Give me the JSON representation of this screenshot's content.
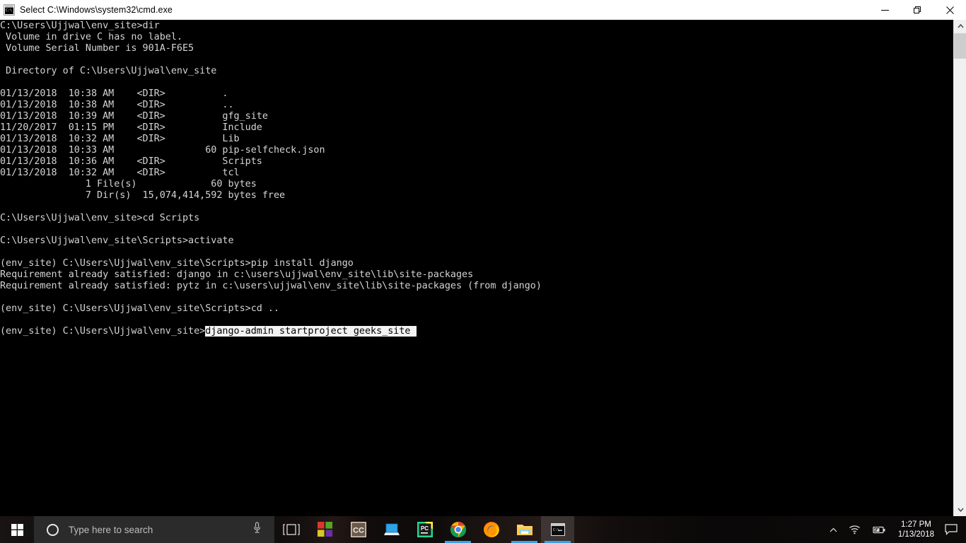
{
  "window": {
    "title": "Select C:\\Windows\\system32\\cmd.exe",
    "icon": "cmd-console-icon",
    "icon_glyph": "C:\\_",
    "controls": {
      "minimize_label": "Minimize",
      "restore_label": "Restore",
      "close_label": "Close"
    }
  },
  "console": {
    "background_color": "#000000",
    "foreground_color": "#d4d4d4",
    "selection_background": "#f2f2f2",
    "selection_foreground": "#000000",
    "lines": [
      {
        "text": "C:\\Users\\Ujjwal\\env_site>dir"
      },
      {
        "text": " Volume in drive C has no label."
      },
      {
        "text": " Volume Serial Number is 901A-F6E5"
      },
      {
        "text": ""
      },
      {
        "text": " Directory of C:\\Users\\Ujjwal\\env_site"
      },
      {
        "text": ""
      },
      {
        "text": "01/13/2018  10:38 AM    <DIR>          ."
      },
      {
        "text": "01/13/2018  10:38 AM    <DIR>          .."
      },
      {
        "text": "01/13/2018  10:39 AM    <DIR>          gfg_site"
      },
      {
        "text": "11/20/2017  01:15 PM    <DIR>          Include"
      },
      {
        "text": "01/13/2018  10:32 AM    <DIR>          Lib"
      },
      {
        "text": "01/13/2018  10:33 AM                60 pip-selfcheck.json"
      },
      {
        "text": "01/13/2018  10:36 AM    <DIR>          Scripts"
      },
      {
        "text": "01/13/2018  10:32 AM    <DIR>          tcl"
      },
      {
        "text": "               1 File(s)             60 bytes"
      },
      {
        "text": "               7 Dir(s)  15,074,414,592 bytes free"
      },
      {
        "text": ""
      },
      {
        "text": "C:\\Users\\Ujjwal\\env_site>cd Scripts"
      },
      {
        "text": ""
      },
      {
        "text": "C:\\Users\\Ujjwal\\env_site\\Scripts>activate"
      },
      {
        "text": ""
      },
      {
        "text": "(env_site) C:\\Users\\Ujjwal\\env_site\\Scripts>pip install django"
      },
      {
        "text": "Requirement already satisfied: django in c:\\users\\ujjwal\\env_site\\lib\\site-packages"
      },
      {
        "text": "Requirement already satisfied: pytz in c:\\users\\ujjwal\\env_site\\lib\\site-packages (from django)"
      },
      {
        "text": ""
      },
      {
        "text": "(env_site) C:\\Users\\Ujjwal\\env_site\\Scripts>cd .."
      },
      {
        "text": ""
      },
      {
        "prompt": "(env_site) C:\\Users\\Ujjwal\\env_site>",
        "selected": "django-admin startproject geeks_site "
      }
    ]
  },
  "scrollbar": {
    "up_arrow": "chevron-up-icon",
    "down_arrow": "chevron-down-icon",
    "thumb_color": "#cdcdcd",
    "track_color": "#f0f0f0"
  },
  "taskbar": {
    "start_button": "windows-start-icon",
    "search": {
      "placeholder": "Type here to search",
      "cortana_icon": "cortana-circle-icon",
      "mic_icon": "microphone-icon"
    },
    "task_view_icon": "task-view-icon",
    "apps": [
      {
        "name": "microsoft-store",
        "label": "Microsoft Store",
        "running": false,
        "active": false
      },
      {
        "name": "camtasia-cc",
        "label": "CC",
        "running": false,
        "active": false
      },
      {
        "name": "remote-desktop",
        "label": "Remote Desktop",
        "running": false,
        "active": false
      },
      {
        "name": "pycharm",
        "label": "PyCharm",
        "running": false,
        "active": false
      },
      {
        "name": "google-chrome",
        "label": "Google Chrome",
        "running": true,
        "active": false
      },
      {
        "name": "mozilla-firefox",
        "label": "Mozilla Firefox",
        "running": false,
        "active": false
      },
      {
        "name": "file-explorer",
        "label": "File Explorer",
        "running": true,
        "active": false
      },
      {
        "name": "command-prompt",
        "label": "Command Prompt",
        "running": true,
        "active": true
      }
    ],
    "tray": {
      "show_hidden_icons": "chevron-up-icon",
      "network_icon": "wifi-icon",
      "battery_icon": "battery-charging-icon",
      "time": "1:27 PM",
      "date": "1/13/2018",
      "action_center_icon": "notification-icon"
    }
  }
}
